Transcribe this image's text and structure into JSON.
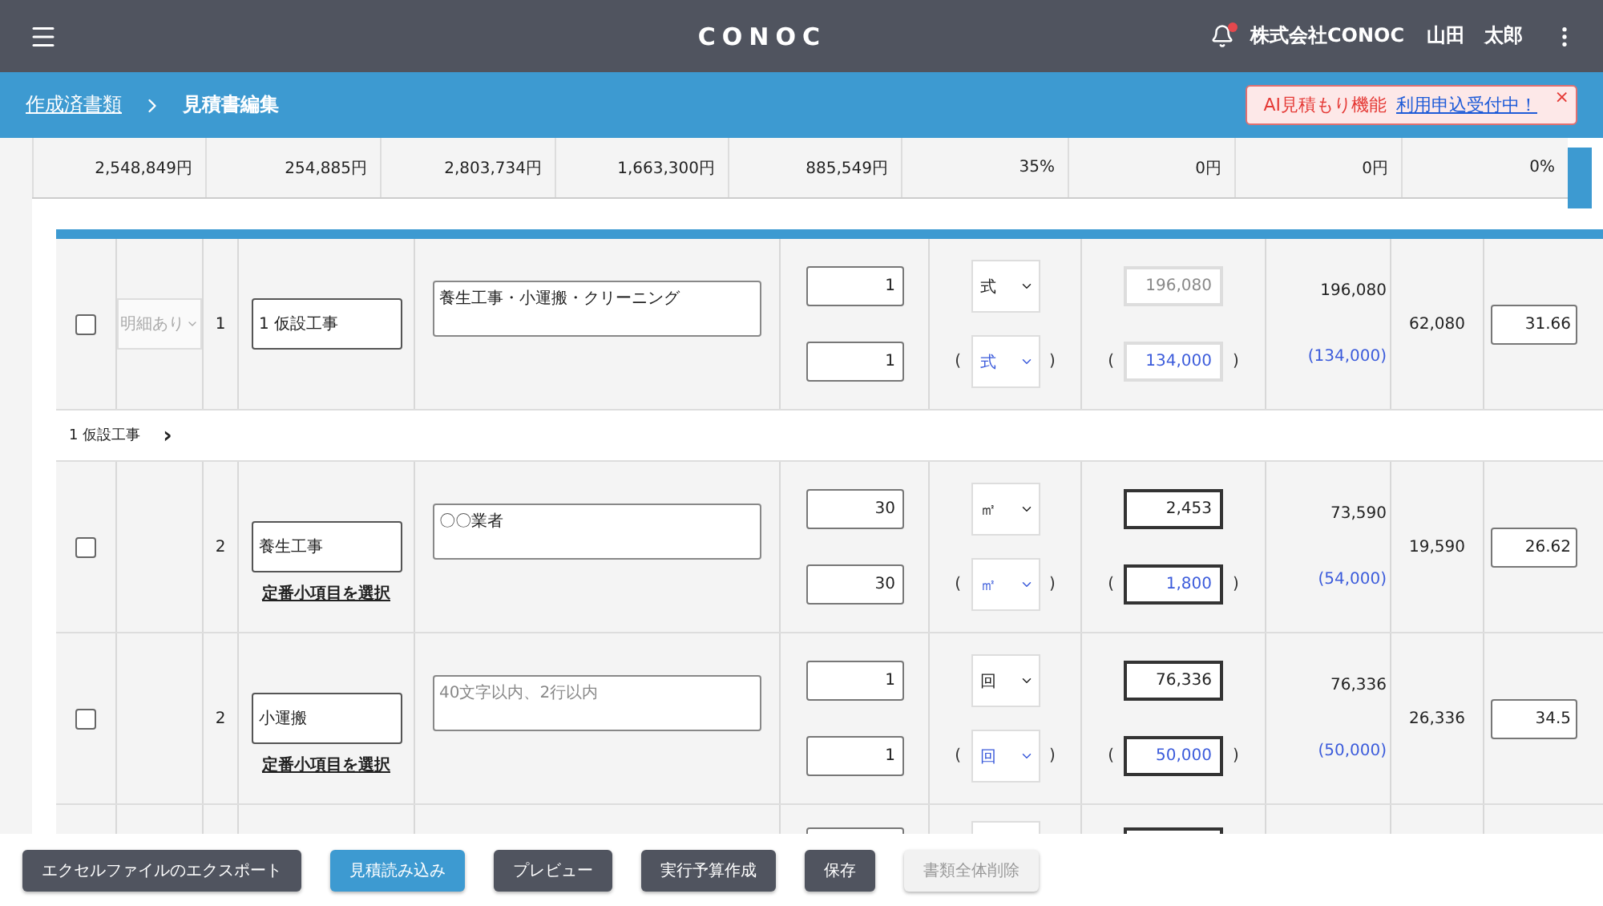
{
  "header": {
    "logo": "CONOC",
    "notification": true,
    "company": "株式会社CONOC",
    "user": "山田　太郎"
  },
  "breadcrumb": {
    "items": [
      {
        "label": "作成済書類",
        "link": true
      },
      {
        "label": "見積書編集",
        "link": false
      }
    ]
  },
  "notice": {
    "label": "AI見積もり機能",
    "link": "利用申込受付中！",
    "close": "×"
  },
  "summary": [
    "2,548,849円",
    "254,885円",
    "2,803,734円",
    "1,663,300円",
    "885,549円",
    "35%",
    "0円",
    "0円",
    "0%"
  ],
  "rows": [
    {
      "kind": "item",
      "checked": false,
      "detail_select": {
        "value": "明細あり",
        "disabled": true
      },
      "no": "1",
      "name": "1 仮設工事",
      "description": {
        "value": "養生工事・小運搬・クリーニング"
      },
      "qty": [
        "1",
        "1"
      ],
      "unit": [
        {
          "value": "式"
        },
        {
          "value": "式",
          "open": "(",
          "close": ")"
        }
      ],
      "price": [
        {
          "value": "196,080",
          "disabled": true,
          "highlighted": false
        },
        {
          "value": "134,000",
          "disabled": false,
          "highlighted": false,
          "open": "(",
          "close": ")"
        }
      ],
      "amount": [
        "196,080",
        "(134,000)"
      ],
      "profit": "62,080",
      "rate": "31.66"
    },
    {
      "kind": "group",
      "label": "1 仮設工事",
      "chevron": "›"
    },
    {
      "kind": "item",
      "checked": false,
      "no": "2",
      "name": "養生工事",
      "link": "定番小項目を選択",
      "description": {
        "value": "〇〇業者"
      },
      "qty": [
        "30",
        "30"
      ],
      "unit": [
        {
          "value": "㎡"
        },
        {
          "value": "㎡",
          "open": "(",
          "close": ")"
        }
      ],
      "price": [
        {
          "value": "2,453",
          "disabled": false,
          "highlighted": true
        },
        {
          "value": "1,800",
          "disabled": false,
          "highlighted": true,
          "open": "(",
          "close": ")"
        }
      ],
      "amount": [
        "73,590",
        "(54,000)"
      ],
      "profit": "19,590",
      "rate": "26.62"
    },
    {
      "kind": "item",
      "checked": false,
      "no": "2",
      "name": "小運搬",
      "link": "定番小項目を選択",
      "description": {
        "placeholder": "40文字以内、2行以内"
      },
      "qty": [
        "1",
        "1"
      ],
      "unit": [
        {
          "value": "回"
        },
        {
          "value": "回",
          "open": "(",
          "close": ")"
        }
      ],
      "price": [
        {
          "value": "76,336",
          "disabled": false,
          "highlighted": true
        },
        {
          "value": "50,000",
          "disabled": false,
          "highlighted": true,
          "open": "(",
          "close": ")"
        }
      ],
      "amount": [
        "76,336",
        "(50,000)"
      ],
      "profit": "26,336",
      "rate": "34.5"
    },
    {
      "kind": "cut"
    }
  ],
  "actions": [
    {
      "label": "エクセルファイルのエクスポート",
      "kind": "dark"
    },
    {
      "label": "見積読み込み",
      "kind": "primary"
    },
    {
      "label": "プレビュー",
      "kind": "dark"
    },
    {
      "label": "実行予算作成",
      "kind": "dark"
    },
    {
      "label": "保存",
      "kind": "dark"
    },
    {
      "label": "書類全体削除",
      "kind": "disabled"
    }
  ]
}
